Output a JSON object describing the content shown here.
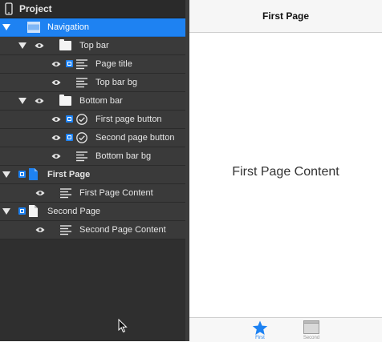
{
  "sidebar": {
    "header": "Project",
    "rows": [
      {
        "label": "Navigation"
      },
      {
        "label": "Top bar"
      },
      {
        "label": "Page title"
      },
      {
        "label": "Top bar bg"
      },
      {
        "label": "Bottom bar"
      },
      {
        "label": "First page button"
      },
      {
        "label": "Second page button"
      },
      {
        "label": "Bottom bar bg"
      },
      {
        "label": "First Page"
      },
      {
        "label": "First Page Content"
      },
      {
        "label": "Second Page"
      },
      {
        "label": "Second Page Content"
      }
    ]
  },
  "preview": {
    "title": "First Page",
    "content": "First Page Content",
    "tabs": [
      {
        "label": "First",
        "icon": "star-icon",
        "color": "#1e82f2"
      },
      {
        "label": "Second",
        "icon": "window-icon",
        "color": "#9a9a9a"
      }
    ]
  },
  "colors": {
    "accent": "#1e82f2",
    "sidebar_bg": "#2f2f2f",
    "row_bg": "#3a3a3a"
  }
}
